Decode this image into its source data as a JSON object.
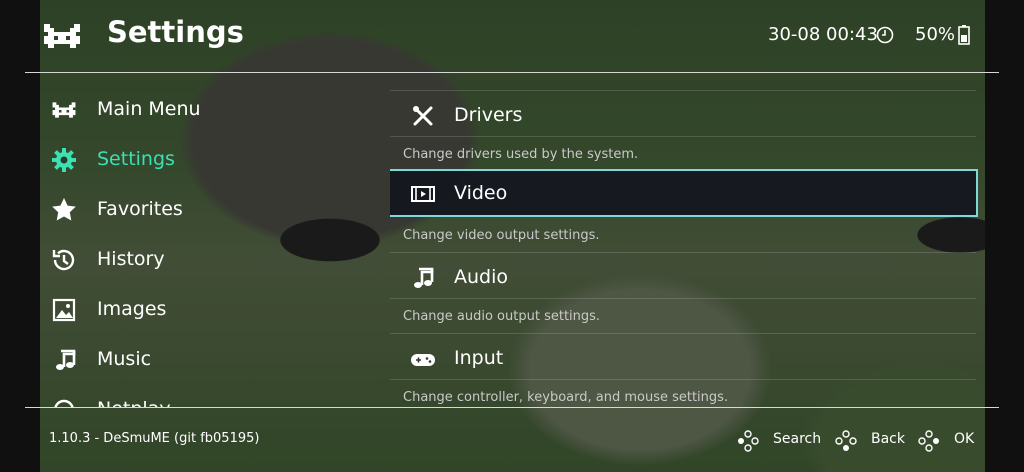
{
  "header": {
    "title": "Settings",
    "clock": "30-08 00:43",
    "battery": "50%"
  },
  "sidebar": {
    "items": [
      {
        "label": "Main Menu",
        "icon": "retroarch-invader-icon"
      },
      {
        "label": "Settings",
        "icon": "gear-icon",
        "active": true
      },
      {
        "label": "Favorites",
        "icon": "star-icon"
      },
      {
        "label": "History",
        "icon": "history-icon"
      },
      {
        "label": "Images",
        "icon": "image-icon"
      },
      {
        "label": "Music",
        "icon": "music-note-icon"
      },
      {
        "label": "Netplay",
        "icon": "netplay-icon"
      }
    ]
  },
  "settings": {
    "entries": [
      {
        "label": "Drivers",
        "description": "Change drivers used by the system.",
        "icon": "tools-icon"
      },
      {
        "label": "Video",
        "description": "Change video output settings.",
        "icon": "film-icon",
        "selected": true
      },
      {
        "label": "Audio",
        "description": "Change audio output settings.",
        "icon": "music-note-icon"
      },
      {
        "label": "Input",
        "description": "Change controller, keyboard, and mouse settings.",
        "icon": "gamepad-icon"
      }
    ]
  },
  "footer": {
    "version": "1.10.3 - DeSmuME (git fb05195)",
    "hints": [
      {
        "label": "Search",
        "icon": "gamepad-buttons-icon"
      },
      {
        "label": "Back",
        "icon": "gamepad-buttons-icon"
      },
      {
        "label": "OK",
        "icon": "gamepad-buttons-icon"
      }
    ]
  },
  "colors": {
    "accent": "#3be0b4",
    "selection_border": "#7fd8d8"
  }
}
